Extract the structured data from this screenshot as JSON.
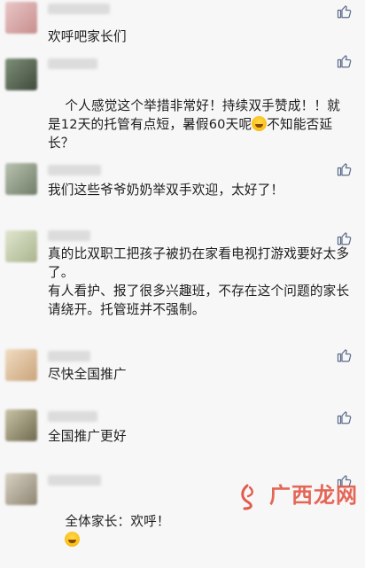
{
  "comments": [
    {
      "text": "欢呼吧家长们"
    },
    {
      "text": "个人感觉这个举措非常好！持续双手赞成！！就是12天的托管有点短，暑假60天呢",
      "text_after_emoji": "不知能否延长？"
    },
    {
      "text": "我们这些爷爷奶奶举双手欢迎，太好了！"
    },
    {
      "text": "真的比双职工把孩子被扔在家看电视打游戏要好太多了。\n有人看护、报了很多兴趣班，不存在这个问题的家长请绕开。托管班并不强制。"
    },
    {
      "text": "尽快全国推广"
    },
    {
      "text": "全国推广更好"
    },
    {
      "text": "全体家长：欢呼！"
    }
  ],
  "icons": {
    "like": "thumbs-up-icon",
    "emoji_laugh": "laughing-emoji-icon",
    "emoji_think": "thinking-emoji-icon"
  },
  "watermark": {
    "text": "广西龙网"
  },
  "colors": {
    "background": "#f7f7f7",
    "like_icon": "#5b6b8a",
    "watermark": "#e35a4a"
  }
}
